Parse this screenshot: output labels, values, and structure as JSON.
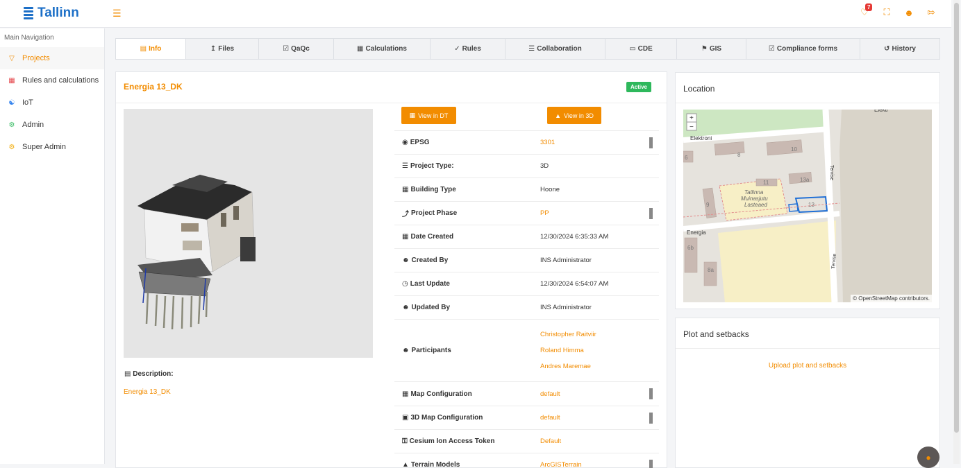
{
  "app": {
    "name": "Tallinn"
  },
  "topbar": {
    "menu_icon": "hamburger-icon",
    "notification_count": "7",
    "icons": [
      "bell-icon",
      "fullscreen-icon",
      "user-icon",
      "logout-icon"
    ]
  },
  "sidebar": {
    "heading": "Main Navigation",
    "items": [
      {
        "label": "Projects",
        "icon": "diamond-icon",
        "color": "#f28c00"
      },
      {
        "label": "Rules and calculations",
        "icon": "grid-icon",
        "color": "#e5484d"
      },
      {
        "label": "IoT",
        "icon": "network-icon",
        "color": "#2f80ed"
      },
      {
        "label": "Admin",
        "icon": "gear-icon",
        "color": "#2eb85c"
      },
      {
        "label": "Super Admin",
        "icon": "gear-icon",
        "color": "#f2a900"
      }
    ]
  },
  "tabs": [
    {
      "label": "Info",
      "icon": "document-icon"
    },
    {
      "label": "Files",
      "icon": "upload-icon"
    },
    {
      "label": "QaQc",
      "icon": "calendar-check-icon"
    },
    {
      "label": "Calculations",
      "icon": "calculator-icon"
    },
    {
      "label": "Rules",
      "icon": "check-icon"
    },
    {
      "label": "Collaboration",
      "icon": "list-icon"
    },
    {
      "label": "CDE",
      "icon": "folder-open-icon"
    },
    {
      "label": "GIS",
      "icon": "map-marker-icon"
    },
    {
      "label": "Compliance forms",
      "icon": "checkbox-icon"
    },
    {
      "label": "History",
      "icon": "history-icon"
    }
  ],
  "project": {
    "title": "Energia 13_DK",
    "status": "Active",
    "view_dt": "View in DT",
    "view_3d": "View in 3D",
    "description_label": "Description:",
    "description": "Energia 13_DK"
  },
  "fields": [
    {
      "label": "EPSG",
      "value": "3301",
      "orange": true,
      "editable": true
    },
    {
      "label": "Project Type:",
      "value": "3D",
      "orange": false,
      "editable": false
    },
    {
      "label": "Building Type",
      "value": "Hoone",
      "orange": false,
      "editable": false
    },
    {
      "label": "Project Phase",
      "value": "PP",
      "orange": true,
      "editable": true
    },
    {
      "label": "Date Created",
      "value": "12/30/2024 6:35:33 AM",
      "orange": false,
      "editable": false
    },
    {
      "label": "Created By",
      "value": "INS Administrator",
      "orange": false,
      "editable": false
    },
    {
      "label": "Last Update",
      "value": "12/30/2024 6:54:07 AM",
      "orange": false,
      "editable": false
    },
    {
      "label": "Updated By",
      "value": "INS Administrator",
      "orange": false,
      "editable": false
    }
  ],
  "participants": {
    "label": "Participants",
    "names": [
      "Christopher Raitviir",
      "Roland Himma",
      "Andres Maremae"
    ]
  },
  "config_fields": [
    {
      "label": "Map Configuration",
      "value": "default",
      "editable": true
    },
    {
      "label": "3D Map Configuration",
      "value": "default",
      "editable": true
    },
    {
      "label": "Cesium Ion Access Token",
      "value": "Default",
      "editable": false
    },
    {
      "label": "Terrain Models",
      "value": "ArcGISTerrain",
      "editable": true
    }
  ],
  "location": {
    "title": "Location",
    "attribution": "© OpenStreetMap contributors.",
    "zoom_in": "+",
    "zoom_out": "−",
    "streets": [
      "Elektroni",
      "Energia",
      "Tervise",
      "Tervise",
      "Elektr"
    ],
    "numbers": [
      "8",
      "10",
      "6",
      "11",
      "13a",
      "13",
      "9",
      "6b",
      "8a"
    ],
    "poi": "Tallinna Muinasjutu Lasteaed"
  },
  "plot": {
    "title": "Plot and setbacks",
    "upload": "Upload plot and setbacks"
  }
}
